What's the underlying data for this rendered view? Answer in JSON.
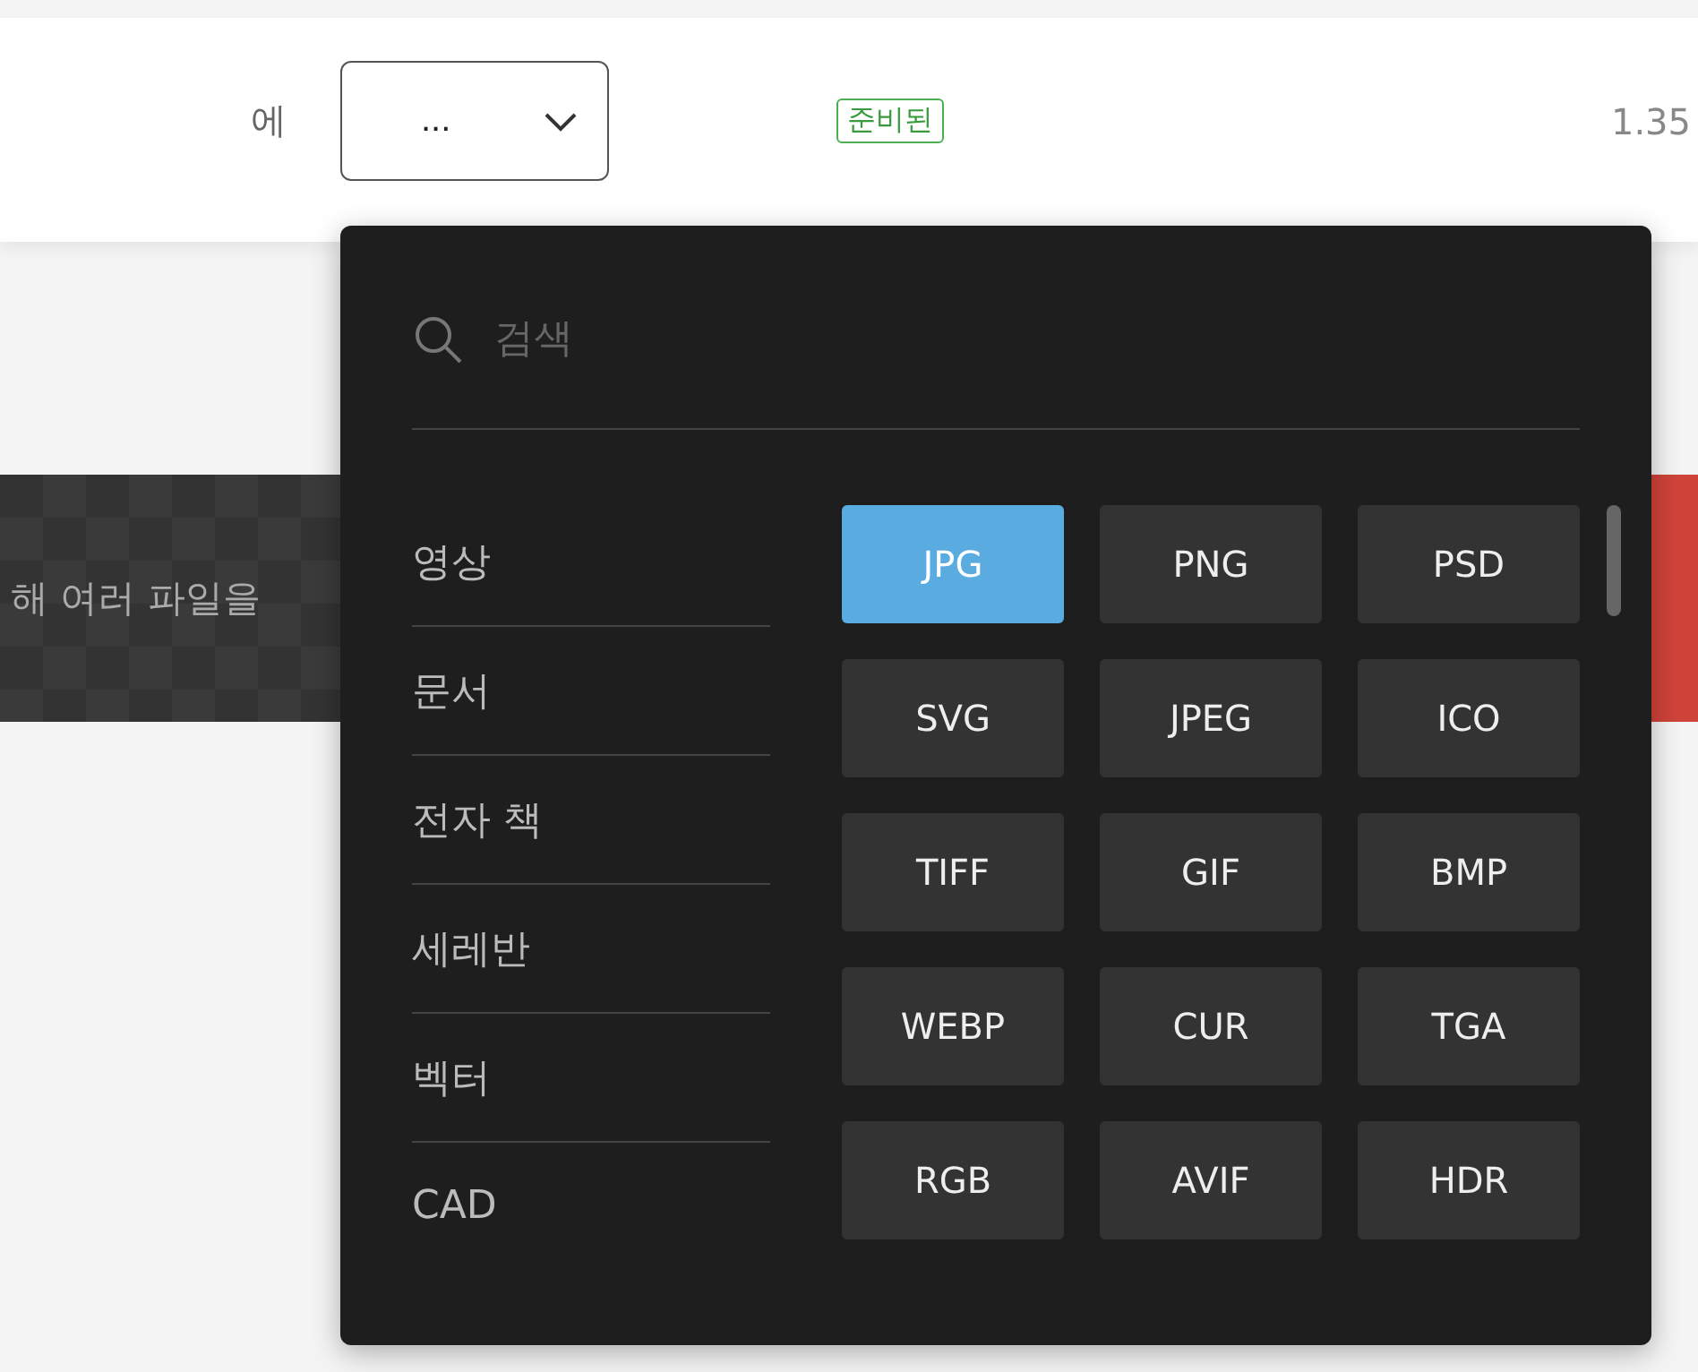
{
  "file_row": {
    "label": "에",
    "select": {
      "value": "..."
    },
    "status": "준비된",
    "size": "1.35"
  },
  "banner": {
    "text": "해 여러 파일을"
  },
  "format_menu": {
    "search": {
      "placeholder": "검색"
    },
    "categories": [
      {
        "label": "영상"
      },
      {
        "label": "문서"
      },
      {
        "label": "전자 책"
      },
      {
        "label": "세레반"
      },
      {
        "label": "벡터"
      },
      {
        "label": "CAD"
      }
    ],
    "formats": [
      {
        "label": "JPG",
        "selected": true
      },
      {
        "label": "PNG",
        "selected": false
      },
      {
        "label": "PSD",
        "selected": false
      },
      {
        "label": "SVG",
        "selected": false
      },
      {
        "label": "JPEG",
        "selected": false
      },
      {
        "label": "ICO",
        "selected": false
      },
      {
        "label": "TIFF",
        "selected": false
      },
      {
        "label": "GIF",
        "selected": false
      },
      {
        "label": "BMP",
        "selected": false
      },
      {
        "label": "WEBP",
        "selected": false
      },
      {
        "label": "CUR",
        "selected": false
      },
      {
        "label": "TGA",
        "selected": false
      },
      {
        "label": "RGB",
        "selected": false
      },
      {
        "label": "AVIF",
        "selected": false
      },
      {
        "label": "HDR",
        "selected": false
      }
    ]
  }
}
